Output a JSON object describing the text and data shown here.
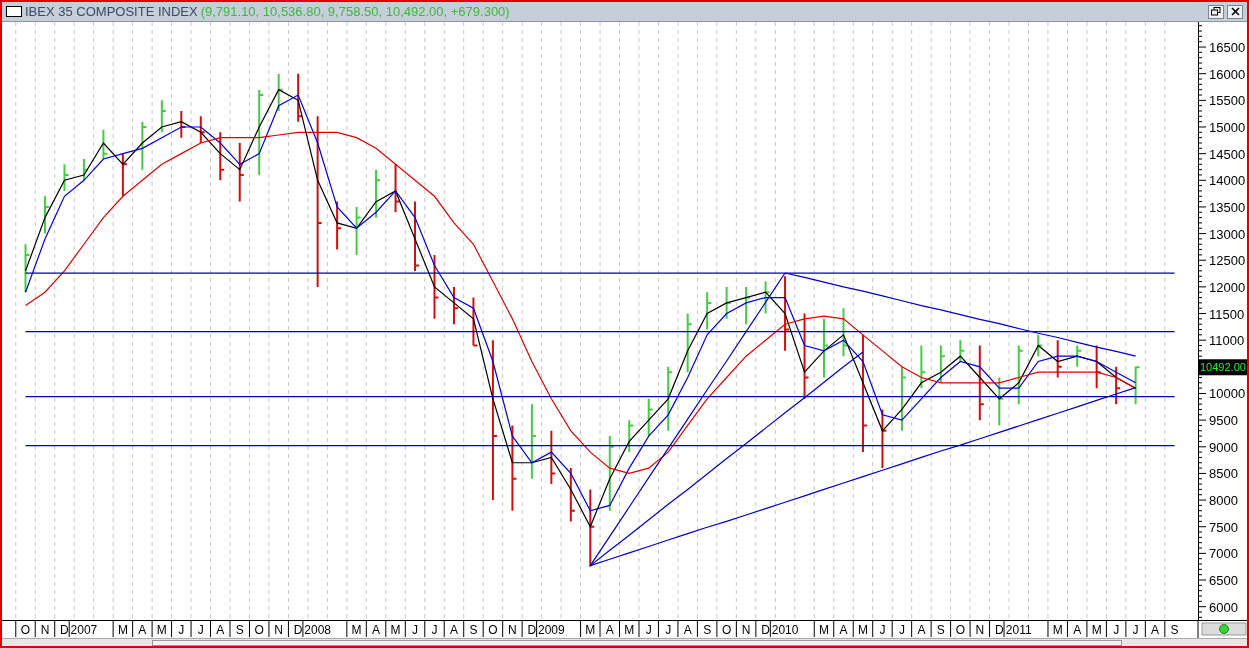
{
  "window": {
    "title": "IBEX 35 COMPOSITE INDEX",
    "quote": "(9,791.10, 10,536.80, 9,758.50, 10,492.00, +679.300)"
  },
  "chart": {
    "last_price": "10492.00",
    "chart_data": {
      "type": "line",
      "ylim": [
        5750,
        16970
      ],
      "categories": [
        "O",
        "N",
        "D",
        "2007",
        null,
        "M",
        "A",
        "M",
        "J",
        "J",
        "A",
        "S",
        "O",
        "N",
        "D",
        "2008",
        null,
        "M",
        "A",
        "M",
        "J",
        "J",
        "A",
        "S",
        "O",
        "N",
        "D",
        "2009",
        null,
        "M",
        "A",
        "M",
        "J",
        "J",
        "A",
        "S",
        "O",
        "N",
        "D",
        "2010",
        null,
        "M",
        "A",
        "M",
        "J",
        "J",
        "A",
        "S",
        "O",
        "N",
        "D",
        "2011",
        null,
        "M",
        "A",
        "M",
        "J",
        "J",
        "A",
        "S"
      ],
      "series": [
        {
          "color": "#000000",
          "values": [
            12300,
            13300,
            14000,
            14100,
            14700,
            14300,
            14700,
            15000,
            15100,
            14900,
            14500,
            14200,
            15000,
            15700,
            15500,
            14000,
            13200,
            13100,
            13600,
            13800,
            12900,
            12000,
            11700,
            11400,
            9900,
            8700,
            8700,
            8800,
            8200,
            7500,
            8400,
            9100,
            9500,
            9900,
            10800,
            11500,
            11700,
            11800,
            11900,
            11500,
            10400,
            10800,
            11100,
            10200,
            9300,
            9700,
            10200,
            10400,
            10700,
            10300,
            9900,
            10200,
            10900,
            10600,
            10700,
            10600,
            10300,
            10100,
            null,
            null
          ]
        },
        {
          "color": "#0000e0",
          "values": [
            11900,
            12900,
            13700,
            14000,
            14400,
            14500,
            14600,
            14800,
            15000,
            15000,
            14700,
            14300,
            14500,
            15400,
            15600,
            14700,
            13500,
            13100,
            13400,
            13800,
            13300,
            12400,
            11800,
            11600,
            10600,
            9200,
            8700,
            8900,
            8500,
            7800,
            7900,
            8600,
            9200,
            9600,
            10300,
            11100,
            11500,
            11700,
            11800,
            11800,
            10900,
            10800,
            11000,
            10600,
            9600,
            9500,
            9900,
            10300,
            10600,
            10500,
            10100,
            10100,
            10600,
            10700,
            10700,
            10600,
            10400,
            10200,
            null,
            null
          ]
        },
        {
          "color": "#e00000",
          "values": [
            11650,
            11900,
            12300,
            12800,
            13300,
            13700,
            14000,
            14300,
            14500,
            14700,
            14800,
            14800,
            14800,
            14850,
            14900,
            14900,
            14900,
            14800,
            14600,
            14300,
            14000,
            13700,
            13200,
            12800,
            12100,
            11400,
            10600,
            9900,
            9300,
            8900,
            8600,
            8500,
            8600,
            8900,
            9400,
            9900,
            10300,
            10700,
            11000,
            11300,
            11400,
            11450,
            11400,
            11100,
            10800,
            10500,
            10300,
            10200,
            10200,
            10200,
            10200,
            10300,
            10400,
            10400,
            10400,
            10400,
            10300,
            10100,
            null,
            null
          ]
        },
        {
          "color": "#0000c0",
          "values": [
            null,
            null,
            null,
            null,
            null,
            null,
            null,
            null,
            null,
            null,
            null,
            null,
            null,
            null,
            null,
            null,
            null,
            null,
            null,
            null,
            null,
            null,
            null,
            null,
            null,
            null,
            null,
            null,
            null,
            6770,
            7320,
            7870,
            8420,
            8970,
            9520,
            10070,
            10610,
            11160,
            11710,
            12260,
            null,
            null,
            null,
            null,
            null,
            null,
            null,
            null,
            null,
            null,
            null,
            null,
            null,
            null,
            null,
            null,
            null,
            null,
            null,
            null
          ]
        },
        {
          "color": "#0000c0",
          "values": [
            null,
            null,
            null,
            null,
            null,
            null,
            null,
            null,
            null,
            null,
            null,
            null,
            null,
            null,
            null,
            null,
            null,
            null,
            null,
            null,
            null,
            null,
            null,
            null,
            null,
            null,
            null,
            null,
            null,
            6770,
            7060,
            7340,
            7630,
            7920,
            8200,
            8490,
            8780,
            9060,
            9350,
            9640,
            9920,
            10210,
            10500,
            10780,
            null,
            null,
            null,
            null,
            null,
            null,
            null,
            null,
            null,
            null,
            null,
            null,
            null,
            null,
            null,
            null
          ]
        },
        {
          "color": "#0000c0",
          "values": [
            null,
            null,
            null,
            null,
            null,
            null,
            null,
            null,
            null,
            null,
            null,
            null,
            null,
            null,
            null,
            null,
            null,
            null,
            null,
            null,
            null,
            null,
            null,
            null,
            null,
            null,
            null,
            null,
            null,
            6770,
            6890,
            7010,
            7130,
            7250,
            7370,
            7490,
            7600,
            7720,
            7840,
            7960,
            8080,
            8200,
            8320,
            8440,
            8560,
            8680,
            8800,
            8920,
            9030,
            9150,
            9270,
            9390,
            9510,
            9630,
            9750,
            9870,
            9990,
            10110,
            null,
            null
          ]
        },
        {
          "color": "#0000c0",
          "values": [
            null,
            null,
            null,
            null,
            null,
            null,
            null,
            null,
            null,
            null,
            null,
            null,
            null,
            null,
            null,
            null,
            null,
            null,
            null,
            null,
            null,
            null,
            null,
            null,
            null,
            null,
            null,
            null,
            null,
            null,
            null,
            null,
            null,
            null,
            null,
            null,
            null,
            null,
            null,
            12260,
            12180,
            12090,
            12000,
            11920,
            11830,
            11740,
            11650,
            11570,
            11480,
            11390,
            11310,
            11220,
            11130,
            11050,
            10960,
            10870,
            10790,
            10700,
            null,
            null
          ]
        },
        {
          "color": "#0000c0",
          "values": [
            12260,
            12260,
            12260,
            12260,
            12260,
            12260,
            12260,
            12260,
            12260,
            12260,
            12260,
            12260,
            12260,
            12260,
            12260,
            12260,
            12260,
            12260,
            12260,
            12260,
            12260,
            12260,
            12260,
            12260,
            12260,
            12260,
            12260,
            12260,
            12260,
            12260,
            12260,
            12260,
            12260,
            12260,
            12260,
            12260,
            12260,
            12260,
            12260,
            12260,
            12260,
            12260,
            12260,
            12260,
            12260,
            12260,
            12260,
            12260,
            12260,
            12260,
            12260,
            12260,
            12260,
            12260,
            12260,
            12260,
            12260,
            12260,
            12260,
            12260
          ]
        },
        {
          "color": "#0000c0",
          "values": [
            11160,
            11160,
            11160,
            11160,
            11160,
            11160,
            11160,
            11160,
            11160,
            11160,
            11160,
            11160,
            11160,
            11160,
            11160,
            11160,
            11160,
            11160,
            11160,
            11160,
            11160,
            11160,
            11160,
            11160,
            11160,
            11160,
            11160,
            11160,
            11160,
            11160,
            11160,
            11160,
            11160,
            11160,
            11160,
            11160,
            11160,
            11160,
            11160,
            11160,
            11160,
            11160,
            11160,
            11160,
            11160,
            11160,
            11160,
            11160,
            11160,
            11160,
            11160,
            11160,
            11160,
            11160,
            11160,
            11160,
            11160,
            11160,
            11160,
            11160
          ]
        },
        {
          "color": "#0000c0",
          "values": [
            9940,
            9940,
            9940,
            9940,
            9940,
            9940,
            9940,
            9940,
            9940,
            9940,
            9940,
            9940,
            9940,
            9940,
            9940,
            9940,
            9940,
            9940,
            9940,
            9940,
            9940,
            9940,
            9940,
            9940,
            9940,
            9940,
            9940,
            9940,
            9940,
            9940,
            9940,
            9940,
            9940,
            9940,
            9940,
            9940,
            9940,
            9940,
            9940,
            9940,
            9940,
            9940,
            9940,
            9940,
            9940,
            9940,
            9940,
            9940,
            9940,
            9940,
            9940,
            9940,
            9940,
            9940,
            9940,
            9940,
            9940,
            9940,
            9940,
            9940
          ]
        },
        {
          "color": "#0000c0",
          "values": [
            9020,
            9020,
            9020,
            9020,
            9020,
            9020,
            9020,
            9020,
            9020,
            9020,
            9020,
            9020,
            9020,
            9020,
            9020,
            9020,
            9020,
            9020,
            9020,
            9020,
            9020,
            9020,
            9020,
            9020,
            9020,
            9020,
            9020,
            9020,
            9020,
            9020,
            9020,
            9020,
            9020,
            9020,
            9020,
            9020,
            9020,
            9020,
            9020,
            9020,
            9020,
            9020,
            9020,
            9020,
            9020,
            9020,
            9020,
            9020,
            9020,
            9020,
            9020,
            9020,
            9020,
            9020,
            9020,
            9020,
            9020,
            9020,
            9020,
            9020
          ]
        }
      ],
      "yticks": [
        6000,
        6500,
        7000,
        7500,
        8000,
        8500,
        9000,
        9500,
        10000,
        11000,
        11500,
        12000,
        12500,
        13000,
        13500,
        14000,
        14500,
        15000,
        15500,
        16000,
        16500
      ]
    }
  }
}
